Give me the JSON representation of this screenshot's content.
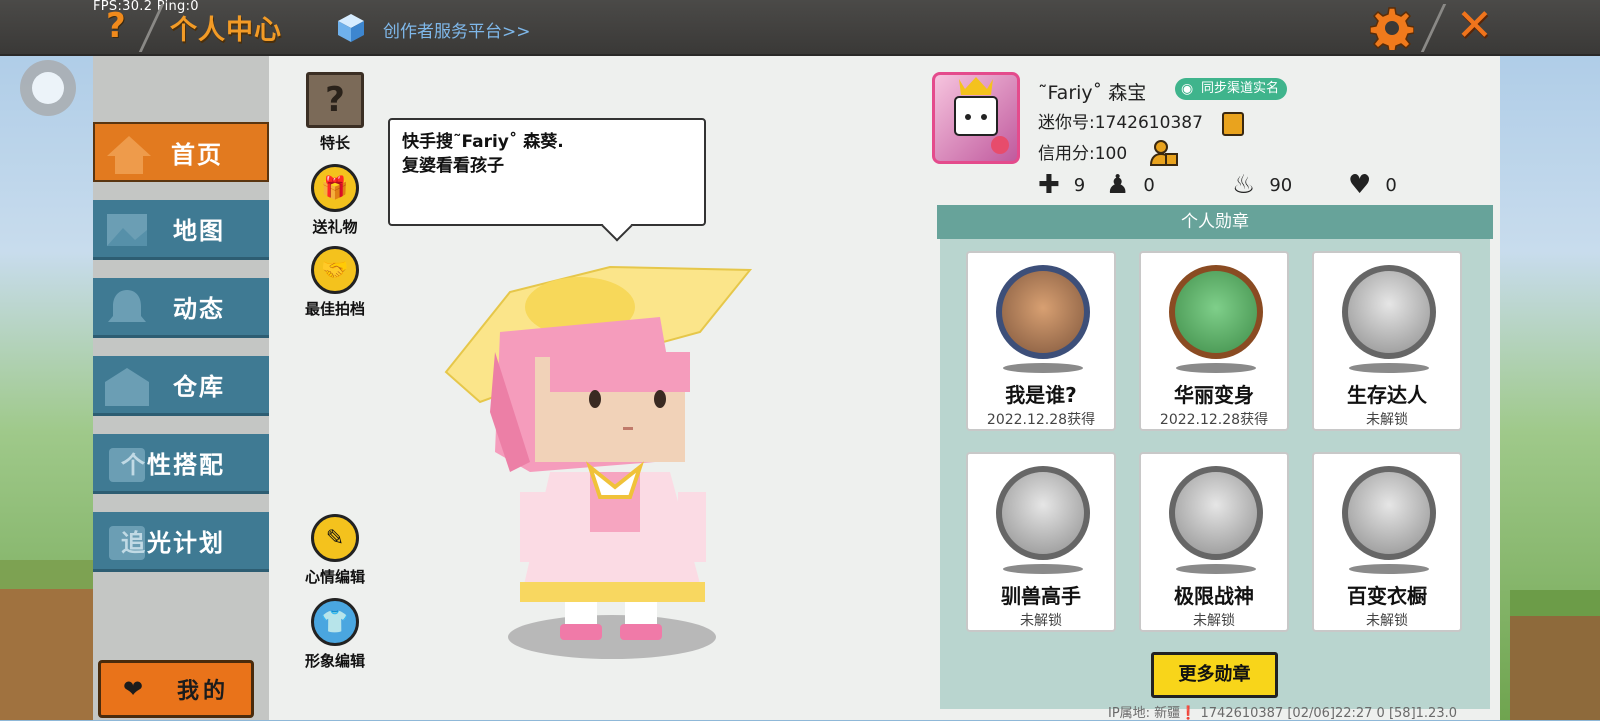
{
  "topbar": {
    "fps": "FPS:30.2  Ping:0",
    "help_symbol": "?",
    "title": "个人中心",
    "creator_link": "创作者服务平台>>",
    "close_symbol": "✕"
  },
  "nav": {
    "items": [
      {
        "label": "首页",
        "active": true
      },
      {
        "label": "地图",
        "active": false
      },
      {
        "label": "动态",
        "active": false
      },
      {
        "label": "仓库",
        "active": false
      },
      {
        "label": "个性搭配",
        "active": false
      },
      {
        "label": "追光计划",
        "active": false
      }
    ],
    "mine_label": "我的"
  },
  "actions": {
    "specialty": "特长",
    "specialty_symbol": "?",
    "gift": "送礼物",
    "partner": "最佳拍档",
    "mood_edit": "心情编辑",
    "avatar_edit": "形象编辑"
  },
  "bubble": {
    "line1": "快手搜˜Fariy˚ 森葵.",
    "line2": "复婆看看孩子"
  },
  "profile": {
    "name": "˜Fariy˚ 森宝",
    "realname_badge": "同步渠道实名",
    "mini_id": "迷你号:1742610387",
    "credit": "信用分:100",
    "stats": [
      {
        "icon": "plus-icon",
        "value": "9"
      },
      {
        "icon": "fans-icon",
        "value": "0"
      },
      {
        "icon": "fire-icon",
        "value": "90"
      },
      {
        "icon": "heart-icon",
        "value": "0"
      }
    ]
  },
  "badges": {
    "header": "个人勋章",
    "items": [
      {
        "name": "我是谁?",
        "status": "2022.12.28获得",
        "style": "blue"
      },
      {
        "name": "华丽变身",
        "status": "2022.12.28获得",
        "style": "bronze"
      },
      {
        "name": "生存达人",
        "status": "未解锁",
        "style": "grey"
      },
      {
        "name": "驯兽高手",
        "status": "未解锁",
        "style": "grey"
      },
      {
        "name": "极限战神",
        "status": "未解锁",
        "style": "grey"
      },
      {
        "name": "百变衣橱",
        "status": "未解锁",
        "style": "grey"
      }
    ],
    "more_label": "更多勋章"
  },
  "footer": "IP属地: 新疆❗   1742610387   [02/06]22:27 0  [58]1.23.0",
  "colors": {
    "accent_orange": "#e27a1f",
    "nav_blue": "#3f7a93",
    "badge_header": "#67a39a",
    "more_button": "#f8d51a"
  }
}
